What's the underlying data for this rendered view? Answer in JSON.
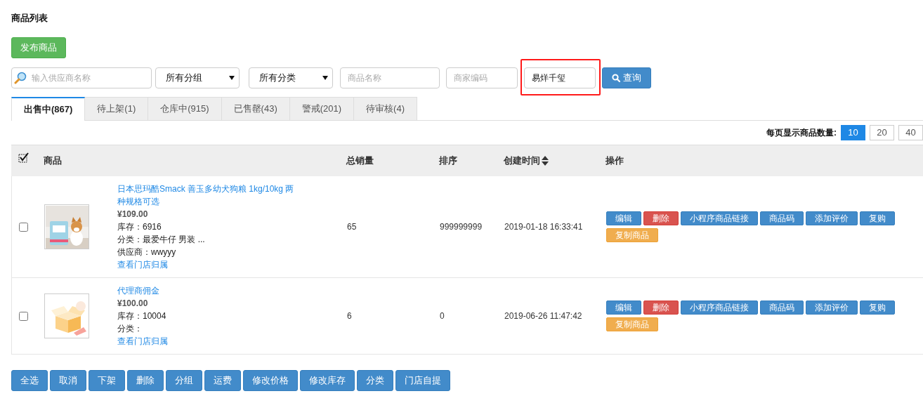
{
  "page_title": "商品列表",
  "publish_button": "发布商品",
  "filters": {
    "supplier": {
      "placeholder": "输入供应商名称"
    },
    "group_select": "所有分组",
    "category_select": "所有分类",
    "name": {
      "placeholder": "商品名称"
    },
    "merchant_code": {
      "placeholder": "商家编码"
    },
    "keyword": {
      "value": "易烊千玺",
      "highlighted": true
    },
    "query_button": "查询"
  },
  "tabs": [
    {
      "label": "出售中(867)",
      "selected": true
    },
    {
      "label": "待上架(1)",
      "selected": false
    },
    {
      "label": "仓库中(915)",
      "selected": false
    },
    {
      "label": "已售罄(43)",
      "selected": false
    },
    {
      "label": "警戒(201)",
      "selected": false
    },
    {
      "label": "待审核(4)",
      "selected": false
    }
  ],
  "page_size": {
    "label": "每页显示商品数量:",
    "options": [
      {
        "label": "10",
        "selected": true
      },
      {
        "label": "20",
        "selected": false
      },
      {
        "label": "40",
        "selected": false
      }
    ]
  },
  "table": {
    "select_all_checked": true,
    "columns": [
      "商品",
      "总销量",
      "排序",
      "创建时间",
      "操作"
    ],
    "rows": [
      {
        "checked": false,
        "name": "日本思玛酷Smack 善玉多幼犬狗粮 1kg/10kg 两种规格可选",
        "price": "¥109.00",
        "stock": "库存：6916",
        "category": "分类：最爱牛仔 男装 ...",
        "supplier": "供应商：wwyyy",
        "store_link": "查看门店归属",
        "sales": "65",
        "sort": "999999999",
        "created": "2019-01-18 16:33:41",
        "actions": [
          {
            "label": "编辑",
            "kind": "primary"
          },
          {
            "label": "删除",
            "kind": "danger"
          },
          {
            "label": "小程序商品链接",
            "kind": "primary"
          },
          {
            "label": "商品码",
            "kind": "primary"
          },
          {
            "label": "添加评价",
            "kind": "primary"
          },
          {
            "label": "复购",
            "kind": "primary"
          },
          {
            "label": "复制商品",
            "kind": "warning"
          }
        ]
      },
      {
        "checked": false,
        "name": "代理商佣金",
        "price": "¥100.00",
        "stock": "库存：10004",
        "category": "分类：",
        "store_link": "查看门店归属",
        "sales": "6",
        "sort": "0",
        "created": "2019-06-26 11:47:42",
        "actions": [
          {
            "label": "编辑",
            "kind": "primary"
          },
          {
            "label": "删除",
            "kind": "danger"
          },
          {
            "label": "小程序商品链接",
            "kind": "primary"
          },
          {
            "label": "商品码",
            "kind": "primary"
          },
          {
            "label": "添加评价",
            "kind": "primary"
          },
          {
            "label": "复购",
            "kind": "primary"
          },
          {
            "label": "复制商品",
            "kind": "warning"
          }
        ]
      }
    ]
  },
  "bulk_actions": [
    "全选",
    "取消",
    "下架",
    "删除",
    "分组",
    "运费",
    "修改价格",
    "修改库存",
    "分类",
    "门店自提"
  ]
}
